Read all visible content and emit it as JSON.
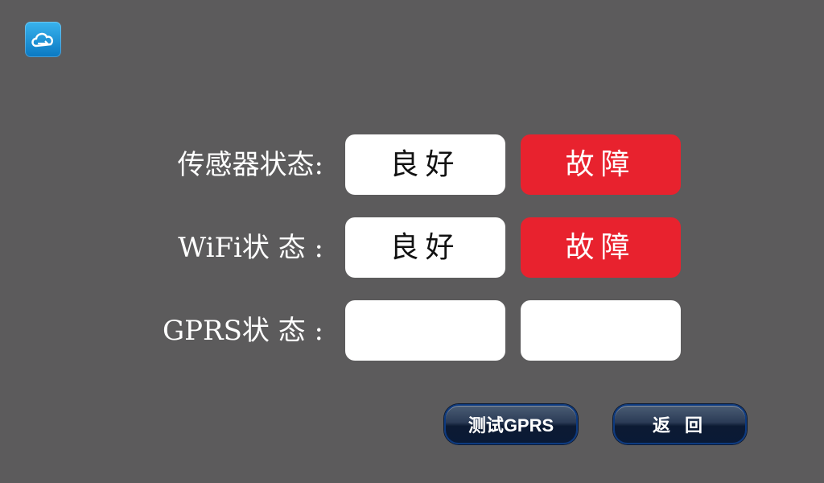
{
  "app": {
    "icon": "cloud-sync-icon"
  },
  "rows": [
    {
      "label": "传感器状态:",
      "good": "良好",
      "fault": "故障"
    },
    {
      "label": "WiFi状 态 :",
      "good": "良好",
      "fault": "故障"
    },
    {
      "label": "GPRS状 态 :",
      "good": "",
      "fault": ""
    }
  ],
  "buttons": {
    "test_gprs": "测试GPRS",
    "back": "返 回"
  },
  "colors": {
    "background": "#5c5b5c",
    "fault": "#e8222e",
    "good": "#ffffff",
    "button": "#1a2a48"
  }
}
